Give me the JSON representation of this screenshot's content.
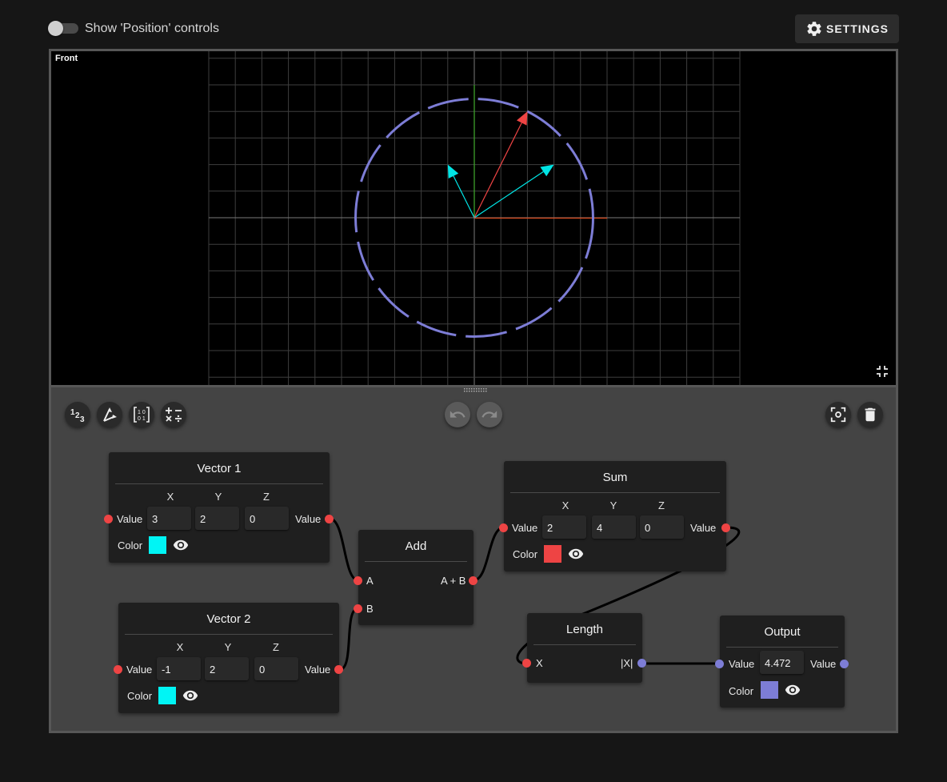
{
  "topbar": {
    "toggle_label": "Show 'Position' controls",
    "settings_label": "SETTINGS"
  },
  "viewport": {
    "view_label": "Front"
  },
  "toolbar": {
    "numbers_icon_text": "123",
    "matrix_icon_text": "10 01",
    "ops_icon_text": "+ − × ÷"
  },
  "nodes": {
    "vector1": {
      "title": "Vector 1",
      "axes": [
        "X",
        "Y",
        "Z"
      ],
      "values": [
        "3",
        "2",
        "0"
      ],
      "in_label": "Value",
      "out_label": "Value",
      "color_label": "Color",
      "color": "#00f5f5"
    },
    "vector2": {
      "title": "Vector 2",
      "axes": [
        "X",
        "Y",
        "Z"
      ],
      "values": [
        "-1",
        "2",
        "0"
      ],
      "in_label": "Value",
      "out_label": "Value",
      "color_label": "Color",
      "color": "#00f5f5"
    },
    "add": {
      "title": "Add",
      "in_a": "A",
      "in_b": "B",
      "out": "A + B"
    },
    "sum": {
      "title": "Sum",
      "axes": [
        "X",
        "Y",
        "Z"
      ],
      "values": [
        "2",
        "4",
        "0"
      ],
      "in_label": "Value",
      "out_label": "Value",
      "color_label": "Color",
      "color": "#ee4444"
    },
    "length": {
      "title": "Length",
      "in_label": "X",
      "out_label": "|X|"
    },
    "output": {
      "title": "Output",
      "in_label": "Value",
      "value": "4.472",
      "out_label": "Value",
      "color_label": "Color",
      "color": "#7d7dd6"
    }
  },
  "scene": {
    "vectors": [
      {
        "name": "Vector 1",
        "x": 3,
        "y": 2,
        "color": "#00e5e5"
      },
      {
        "name": "Vector 2",
        "x": -1,
        "y": 2,
        "color": "#00e5e5"
      },
      {
        "name": "Sum",
        "x": 2,
        "y": 4,
        "color": "#ee4444"
      }
    ],
    "circle_radius": 4.472,
    "circle_color": "#7d7dd6"
  }
}
